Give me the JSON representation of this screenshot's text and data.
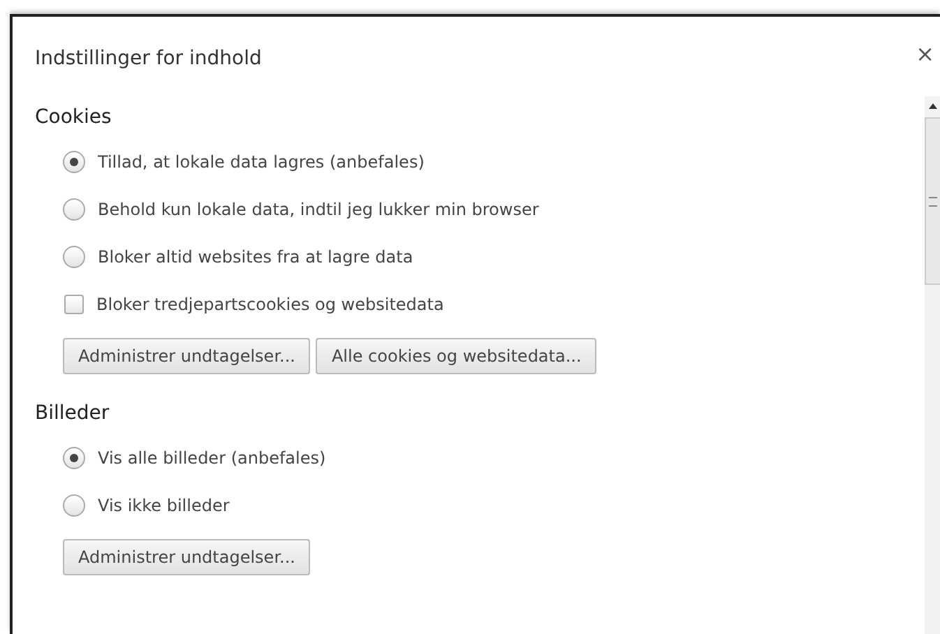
{
  "dialog": {
    "title": "Indstillinger for indhold",
    "close": "×"
  },
  "sections": [
    {
      "heading": "Cookies",
      "options": [
        {
          "kind": "radio",
          "label": "Tillad, at lokale data lagres (anbefales)",
          "selected": true
        },
        {
          "kind": "radio",
          "label": "Behold kun lokale data, indtil jeg lukker min browser",
          "selected": false
        },
        {
          "kind": "radio",
          "label": "Bloker altid websites fra at lagre data",
          "selected": false
        },
        {
          "kind": "checkbox",
          "label": "Bloker tredjepartscookies og websitedata",
          "checked": false
        }
      ],
      "buttons": [
        "Administrer undtagelser...",
        "Alle cookies og websitedata..."
      ]
    },
    {
      "heading": "Billeder",
      "options": [
        {
          "kind": "radio",
          "label": "Vis alle billeder (anbefales)",
          "selected": true
        },
        {
          "kind": "radio",
          "label": "Vis ikke billeder",
          "selected": false
        }
      ],
      "buttons": [
        "Administrer undtagelser..."
      ]
    }
  ]
}
